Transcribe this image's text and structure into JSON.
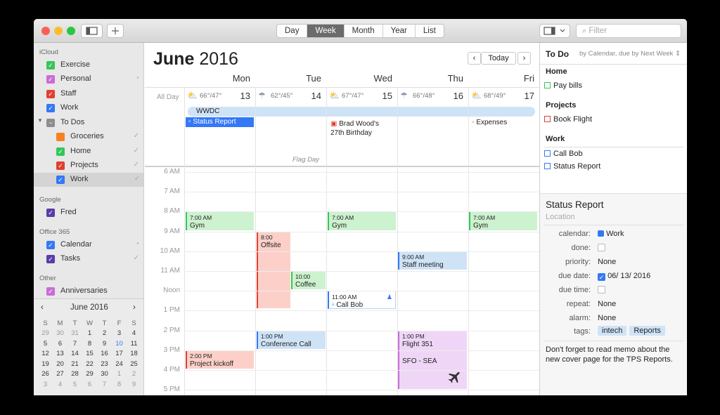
{
  "toolbar": {
    "views": [
      "Day",
      "Week",
      "Month",
      "Year",
      "List"
    ],
    "selected_view": "Week",
    "filter_placeholder": "Filter"
  },
  "sidebar": {
    "sections": [
      {
        "title": "iCloud",
        "items": [
          {
            "label": "Exercise",
            "color": "#34c759"
          },
          {
            "label": "Personal",
            "color": "#c86dd7"
          },
          {
            "label": "Staff",
            "color": "#e0402f"
          },
          {
            "label": "Work",
            "color": "#3478f6"
          },
          {
            "label": "To Dos",
            "color": "#8e8e8e"
          },
          {
            "label": "Groceries",
            "color": "#f5821f"
          },
          {
            "label": "Home",
            "color": "#34c759"
          },
          {
            "label": "Projects",
            "color": "#e0402f"
          },
          {
            "label": "Work",
            "color": "#3478f6"
          }
        ]
      },
      {
        "title": "Google",
        "items": [
          {
            "label": "Fred",
            "color": "#5b3ca8"
          }
        ]
      },
      {
        "title": "Office 365",
        "items": [
          {
            "label": "Calendar",
            "color": "#3478f6"
          },
          {
            "label": "Tasks",
            "color": "#5b3ca8"
          }
        ]
      },
      {
        "title": "Other",
        "items": [
          {
            "label": "Anniversaries",
            "color": "#c86dd7"
          }
        ]
      }
    ],
    "mini_calendar": {
      "title": "June 2016",
      "weekdays": [
        "S",
        "M",
        "T",
        "W",
        "T",
        "F",
        "S"
      ],
      "weeks": [
        [
          "29",
          "30",
          "31",
          "1",
          "2",
          "3",
          "4"
        ],
        [
          "5",
          "6",
          "7",
          "8",
          "9",
          "10",
          "11"
        ],
        [
          "12",
          "13",
          "14",
          "15",
          "16",
          "17",
          "18"
        ],
        [
          "19",
          "20",
          "21",
          "22",
          "23",
          "24",
          "25"
        ],
        [
          "26",
          "27",
          "28",
          "29",
          "30",
          "1",
          "2"
        ],
        [
          "3",
          "4",
          "5",
          "6",
          "7",
          "8",
          "9"
        ]
      ]
    }
  },
  "main": {
    "month": "June",
    "year": "2016",
    "today": "Today",
    "allday_label": "All Day",
    "days": [
      {
        "name": "Mon",
        "num": "13",
        "weather": "66°/47°",
        "icon": "sun-cloud"
      },
      {
        "name": "Tue",
        "num": "14",
        "weather": "62°/45°",
        "icon": "rain-cloud"
      },
      {
        "name": "Wed",
        "num": "15",
        "weather": "67°/47°",
        "icon": "sun-cloud"
      },
      {
        "name": "Thu",
        "num": "16",
        "weather": "66°/48°",
        "icon": "rain-cloud"
      },
      {
        "name": "Fri",
        "num": "17",
        "weather": "68°/49°",
        "icon": "sun-cloud"
      }
    ],
    "allday_events": {
      "wwdc": "WWDC",
      "status_report": "Status Report",
      "birthday": "Brad Wood's 27th Birthday",
      "expenses": "Expenses",
      "flag_day": "Flag Day"
    },
    "hours": [
      "6 AM",
      "7 AM",
      "8 AM",
      "9 AM",
      "10 AM",
      "11 AM",
      "Noon",
      "1 PM",
      "2 PM",
      "3 PM",
      "4 PM",
      "5 PM"
    ],
    "events": {
      "gym_mon": {
        "time": "7:00 AM",
        "title": "Gym"
      },
      "gym_wed": {
        "time": "7:00 AM",
        "title": "Gym"
      },
      "gym_fri": {
        "time": "7:00 AM",
        "title": "Gym"
      },
      "offsite": {
        "time": "8:00",
        "title": "Offsite"
      },
      "coffee": {
        "time": "10:00",
        "title": "Coffee"
      },
      "staff": {
        "time": "9:00 AM",
        "title": "Staff meeting"
      },
      "callbob": {
        "time": "11:00 AM",
        "title": "Call Bob"
      },
      "confcall": {
        "time": "1:00 PM",
        "title": "Conference Call"
      },
      "flight": {
        "time": "1:00 PM",
        "title": "Flight 351",
        "route": "SFO - SEA"
      },
      "kickoff": {
        "time": "2:00 PM",
        "title": "Project kickoff"
      }
    }
  },
  "todo": {
    "title": "To Do",
    "sort": "by Calendar, due by Next Week",
    "groups": [
      {
        "name": "Home",
        "items": [
          "Pay bills"
        ]
      },
      {
        "name": "Projects",
        "items": [
          "Book Flight"
        ]
      },
      {
        "name": "Work",
        "items": [
          "Call Bob",
          "Status Report"
        ]
      }
    ],
    "detail": {
      "title": "Status Report",
      "location": "Location",
      "labels": {
        "calendar": "calendar:",
        "done": "done:",
        "priority": "priority:",
        "due_date": "due date:",
        "due_time": "due time:",
        "repeat": "repeat:",
        "alarm": "alarm:",
        "tags": "tags:"
      },
      "calendar": "Work",
      "priority": "None",
      "due_date": "06/ 13/ 2016",
      "repeat": "None",
      "alarm": "None",
      "tags": [
        "intech",
        "Reports"
      ],
      "notes": "Don't forget to read memo about the new cover page for the TPS Reports."
    }
  }
}
